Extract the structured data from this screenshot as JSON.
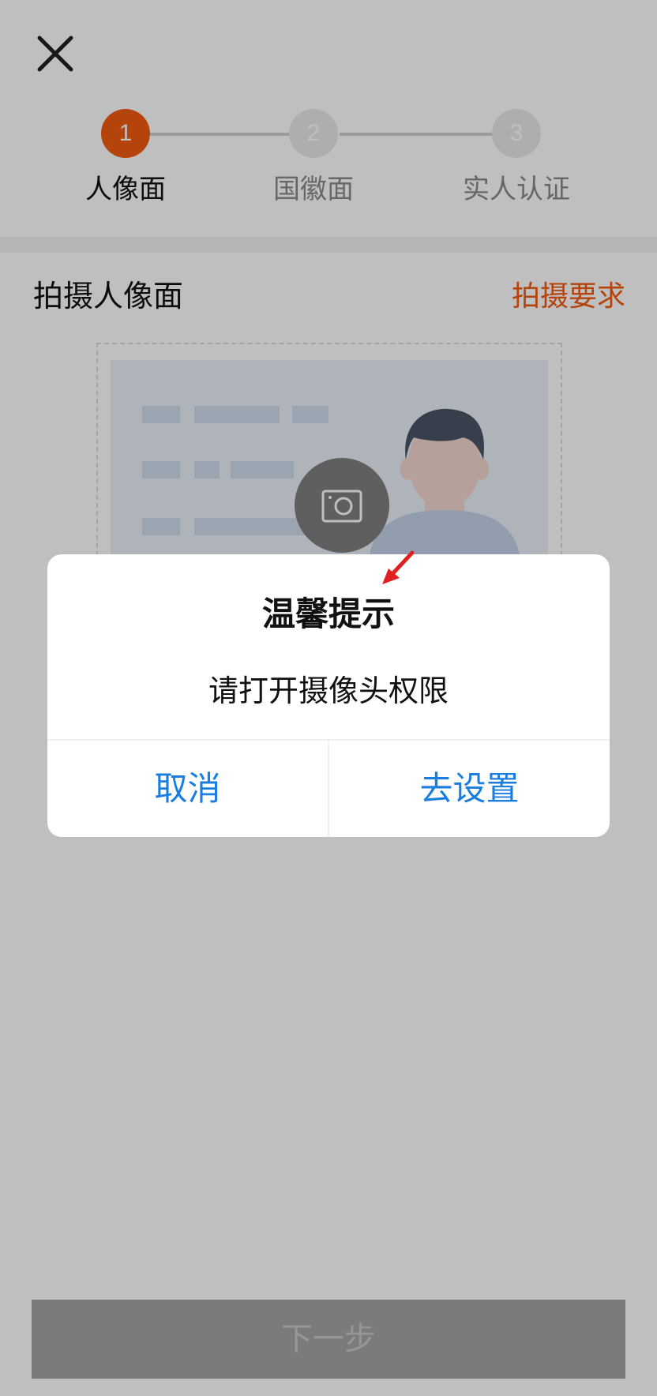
{
  "header": {
    "close_icon": "close-icon",
    "steps": [
      {
        "number": "1",
        "label": "人像面"
      },
      {
        "number": "2",
        "label": "国徽面"
      },
      {
        "number": "3",
        "label": "实人认证"
      }
    ],
    "active_step": 1
  },
  "section": {
    "title": "拍摄人像面",
    "link": "拍摄要求"
  },
  "capture": {
    "camera_icon": "camera-icon"
  },
  "dialog": {
    "title": "温馨提示",
    "message": "请打开摄像头权限",
    "cancel_label": "取消",
    "confirm_label": "去设置"
  },
  "footer": {
    "next_label": "下一步"
  },
  "colors": {
    "accent": "#f15a10",
    "link_blue": "#1a7de0"
  }
}
